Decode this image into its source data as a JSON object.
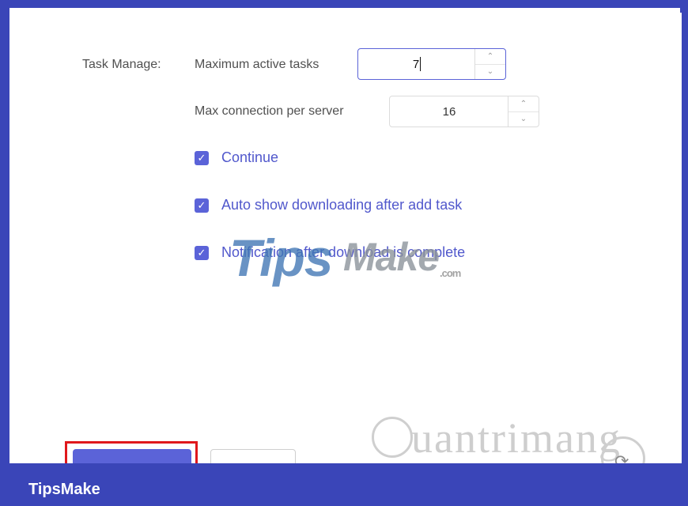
{
  "settings": {
    "section_label": "Task Manage:",
    "max_active_tasks": {
      "label": "Maximum active tasks",
      "value": "7"
    },
    "max_connection_per_server": {
      "label": "Max connection per server",
      "value": "16"
    },
    "options": [
      {
        "label": "Continue",
        "checked": true
      },
      {
        "label": "Auto show downloading after add task",
        "checked": true
      },
      {
        "label": "Notification after download is complete",
        "checked": true
      }
    ]
  },
  "buttons": {
    "confirm_label": "",
    "discard_label": ""
  },
  "watermark": {
    "tips": "Tips",
    "make": "Make",
    "com": ".com",
    "quantrimang": "uantrimang"
  },
  "footer": {
    "brand": "TipsMake"
  },
  "colors": {
    "accent": "#5b63d8",
    "frame": "#3a45b8",
    "highlight": "#e0181c"
  }
}
